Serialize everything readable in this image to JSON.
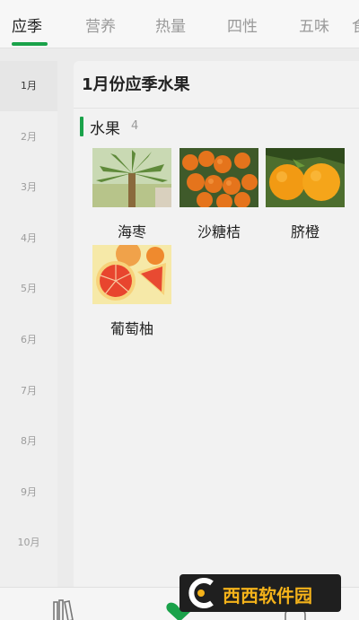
{
  "tabs": [
    "应季",
    "营养",
    "热量",
    "四性",
    "五味",
    "食"
  ],
  "months": [
    "1月",
    "2月",
    "3月",
    "4月",
    "5月",
    "6月",
    "7月",
    "8月",
    "9月",
    "10月"
  ],
  "card": {
    "title": "1月份应季水果",
    "section_title": "水果",
    "section_count": "4"
  },
  "fruits": [
    {
      "name": "海枣",
      "icon": "date-palm-image"
    },
    {
      "name": "沙糖桔",
      "icon": "mandarin-image"
    },
    {
      "name": "脐橙",
      "icon": "navel-orange-image"
    },
    {
      "name": "葡萄柚",
      "icon": "grapefruit-image"
    }
  ],
  "watermark": {
    "text": "西西软件园"
  },
  "colors": {
    "accent": "#1aa24a",
    "watermark_text": "#f4b21a"
  }
}
